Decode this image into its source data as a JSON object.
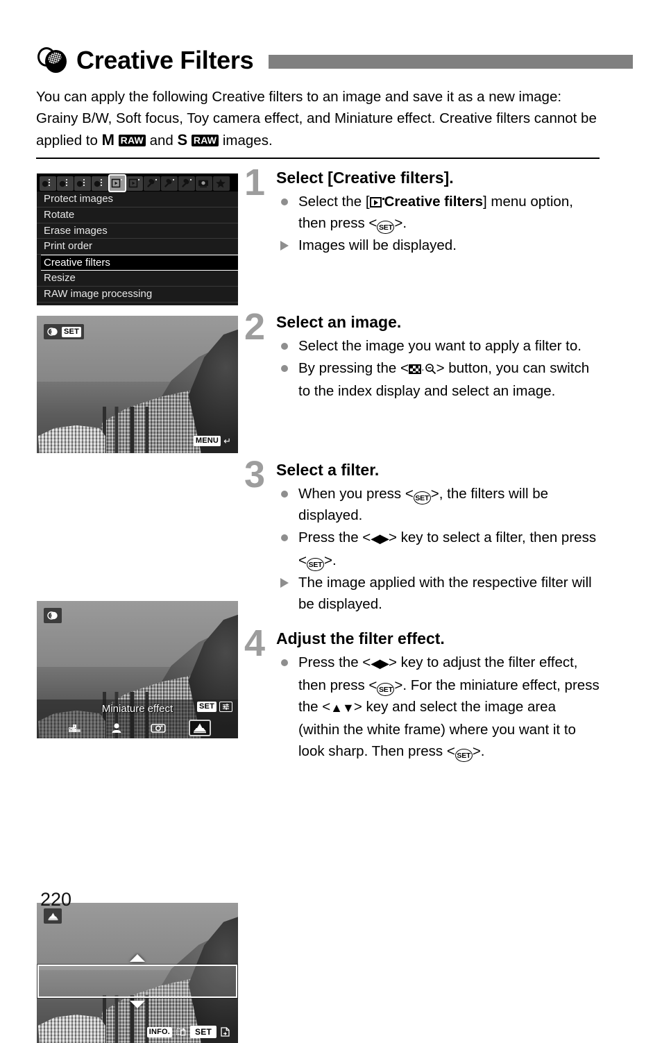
{
  "page": {
    "title": "Creative Filters",
    "header_icon": "creative-filters-icon",
    "number": "220"
  },
  "intro": {
    "part1": "You can apply the following Creative filters to an image and save it as a new image: Grainy B/W, Soft focus, Toy camera effect, and Miniature effect. Creative filters cannot be applied to ",
    "m_letter": "M",
    "raw_chip": "RAW",
    "conjunction": " and ",
    "s_letter": "S",
    "part2": " images."
  },
  "camera_menu": {
    "tabs": [
      {
        "name": "shooting-1",
        "glyph": "camera"
      },
      {
        "name": "shooting-2",
        "glyph": "camera"
      },
      {
        "name": "shooting-3",
        "glyph": "camera"
      },
      {
        "name": "shooting-4",
        "glyph": "camera"
      },
      {
        "name": "playback-1",
        "glyph": "playback",
        "selected": true
      },
      {
        "name": "playback-2",
        "glyph": "playback"
      },
      {
        "name": "setup-1",
        "glyph": "wrench"
      },
      {
        "name": "setup-2",
        "glyph": "wrench"
      },
      {
        "name": "setup-3",
        "glyph": "wrench"
      },
      {
        "name": "custom-functions",
        "glyph": "camera-body"
      },
      {
        "name": "my-menu",
        "glyph": "star"
      }
    ],
    "items": [
      {
        "label": "Protect images",
        "active": false
      },
      {
        "label": "Rotate",
        "active": false
      },
      {
        "label": "Erase images",
        "active": false
      },
      {
        "label": "Print order",
        "active": false
      },
      {
        "label": "Creative filters",
        "active": true
      },
      {
        "label": "Resize",
        "active": false
      },
      {
        "label": "RAW image processing",
        "active": false
      }
    ]
  },
  "screen_select_image": {
    "set_chip": "SET",
    "menu_chip": "MENU",
    "filter_icon": "creative-filters-icon",
    "return_icon": "return-arrow-icon"
  },
  "screen_select_filter": {
    "filter_icon": "creative-filters-icon",
    "filter_name": "Miniature effect",
    "set_chip": "SET",
    "adjust_icon": "sliders-icon",
    "filters": [
      {
        "name": "grainy-bw-filter",
        "selected": false
      },
      {
        "name": "soft-focus-filter",
        "selected": false
      },
      {
        "name": "toy-camera-filter",
        "selected": false
      },
      {
        "name": "miniature-effect-filter",
        "selected": true
      }
    ]
  },
  "screen_adjust_effect": {
    "filter_icon": "miniature-effect-icon",
    "info_chip": "INFO.",
    "orientation_icon": "rotate-frame-icon",
    "set_chip": "SET",
    "save_icon": "save-image-icon",
    "arrow_up": "up-arrow",
    "arrow_down": "down-arrow"
  },
  "steps": [
    {
      "number": "1",
      "title": "Select [Creative filters].",
      "bullets": [
        {
          "marker": "dot",
          "segments": [
            {
              "t": "text",
              "v": "Select the ["
            },
            {
              "t": "icon",
              "v": "playback-tab-icon"
            },
            {
              "t": "bold",
              "v": "Creative filters"
            },
            {
              "t": "text",
              "v": "] menu option, then press <"
            },
            {
              "t": "icon",
              "v": "set-button-icon"
            },
            {
              "t": "text",
              "v": ">."
            }
          ]
        },
        {
          "marker": "triangle",
          "segments": [
            {
              "t": "text",
              "v": "Images will be displayed."
            }
          ]
        }
      ]
    },
    {
      "number": "2",
      "title": "Select an image.",
      "bullets": [
        {
          "marker": "dot",
          "segments": [
            {
              "t": "text",
              "v": "Select the image you want to apply a filter to."
            }
          ]
        },
        {
          "marker": "dot",
          "segments": [
            {
              "t": "text",
              "v": "By pressing the <"
            },
            {
              "t": "icon",
              "v": "index-magnify-button-icon"
            },
            {
              "t": "text",
              "v": "> button, you can switch to the index display and select an image."
            }
          ]
        }
      ]
    },
    {
      "number": "3",
      "title": "Select a filter.",
      "bullets": [
        {
          "marker": "dot",
          "segments": [
            {
              "t": "text",
              "v": "When you press <"
            },
            {
              "t": "icon",
              "v": "set-button-icon"
            },
            {
              "t": "text",
              "v": ">, the filters will be displayed."
            }
          ]
        },
        {
          "marker": "dot",
          "segments": [
            {
              "t": "text",
              "v": "Press the <"
            },
            {
              "t": "icon",
              "v": "left-right-key-icon"
            },
            {
              "t": "text",
              "v": "> key to select a filter, then press <"
            },
            {
              "t": "icon",
              "v": "set-button-icon"
            },
            {
              "t": "text",
              "v": ">."
            }
          ]
        },
        {
          "marker": "triangle",
          "segments": [
            {
              "t": "text",
              "v": "The image applied with the respective filter will be displayed."
            }
          ]
        }
      ]
    },
    {
      "number": "4",
      "title": "Adjust the filter effect.",
      "bullets": [
        {
          "marker": "dot",
          "segments": [
            {
              "t": "text",
              "v": "Press the <"
            },
            {
              "t": "icon",
              "v": "left-right-key-icon"
            },
            {
              "t": "text",
              "v": "> key to adjust the filter effect, then press <"
            },
            {
              "t": "icon",
              "v": "set-button-icon"
            },
            {
              "t": "text",
              "v": ">. For the miniature effect, press the <"
            },
            {
              "t": "icon",
              "v": "up-down-key-icon"
            },
            {
              "t": "text",
              "v": "> key and select the image area (within the white frame) where you want it to look sharp. Then press <"
            },
            {
              "t": "icon",
              "v": "set-button-icon"
            },
            {
              "t": "text",
              "v": ">."
            }
          ]
        }
      ]
    }
  ],
  "colors": {
    "accent_bar": "#808080",
    "step_number": "#9d9d9d",
    "menu_bg": "#1b1b1b",
    "text": "#000000"
  }
}
